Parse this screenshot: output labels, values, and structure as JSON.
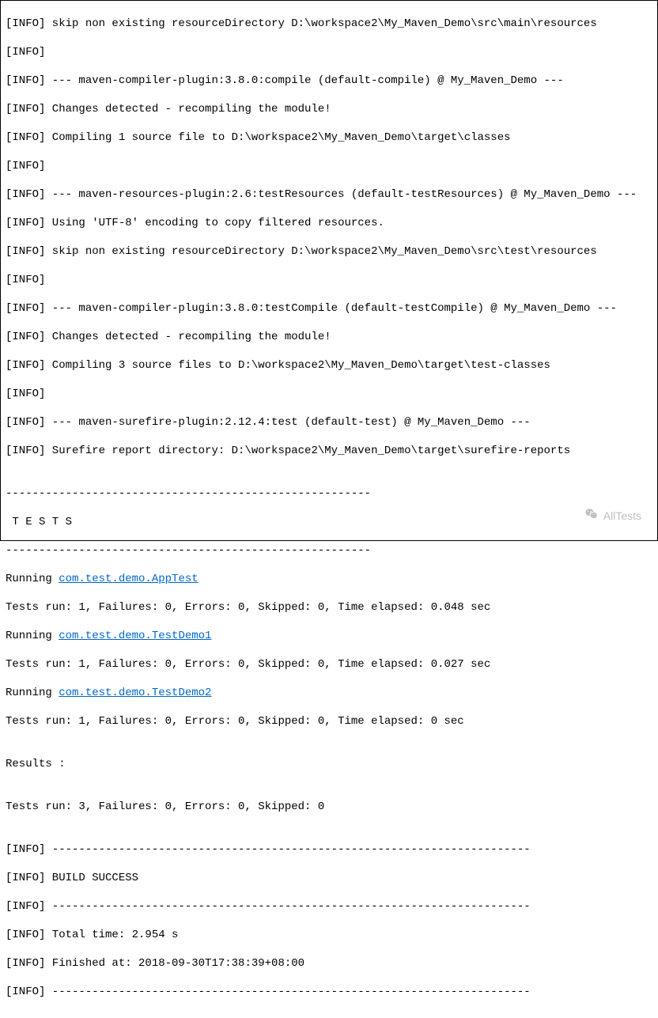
{
  "lines": {
    "l00": "[INFO] skip non existing resourceDirectory D:\\workspace2\\My_Maven_Demo\\src\\main\\resources",
    "l01": "[INFO]",
    "l02": "[INFO] --- maven-compiler-plugin:3.8.0:compile (default-compile) @ My_Maven_Demo ---",
    "l03": "[INFO] Changes detected - recompiling the module!",
    "l04": "[INFO] Compiling 1 source file to D:\\workspace2\\My_Maven_Demo\\target\\classes",
    "l05": "[INFO]",
    "l06": "[INFO] --- maven-resources-plugin:2.6:testResources (default-testResources) @ My_Maven_Demo ---",
    "l07": "[INFO] Using 'UTF-8' encoding to copy filtered resources.",
    "l08": "[INFO] skip non existing resourceDirectory D:\\workspace2\\My_Maven_Demo\\src\\test\\resources",
    "l09": "[INFO]",
    "l10": "[INFO] --- maven-compiler-plugin:3.8.0:testCompile (default-testCompile) @ My_Maven_Demo ---",
    "l11": "[INFO] Changes detected - recompiling the module!",
    "l12": "[INFO] Compiling 3 source files to D:\\workspace2\\My_Maven_Demo\\target\\test-classes",
    "l13": "[INFO]",
    "l14": "[INFO] --- maven-surefire-plugin:2.12.4:test (default-test) @ My_Maven_Demo ---",
    "l15": "[INFO] Surefire report directory: D:\\workspace2\\My_Maven_Demo\\target\\surefire-reports",
    "l16": "",
    "l17": "-------------------------------------------------------",
    "l18": " T E S T S",
    "l19": "-------------------------------------------------------",
    "l20a": "Running ",
    "l20b": "com.test.demo.AppTest",
    "l21": "Tests run: 1, Failures: 0, Errors: 0, Skipped: 0, Time elapsed: 0.048 sec",
    "l22a": "Running ",
    "l22b": "com.test.demo.TestDemo1",
    "l23": "Tests run: 1, Failures: 0, Errors: 0, Skipped: 0, Time elapsed: 0.027 sec",
    "l24a": "Running ",
    "l24b": "com.test.demo.TestDemo2",
    "l25": "Tests run: 1, Failures: 0, Errors: 0, Skipped: 0, Time elapsed: 0 sec",
    "l26": "",
    "l27": "Results :",
    "l28": "",
    "l29": "Tests run: 3, Failures: 0, Errors: 0, Skipped: 0",
    "l30": "",
    "l31": "[INFO] ------------------------------------------------------------------------",
    "l32": "[INFO] BUILD SUCCESS",
    "l33": "[INFO] ------------------------------------------------------------------------",
    "l34": "[INFO] Total time: 2.954 s",
    "l35": "[INFO] Finished at: 2018-09-30T17:38:39+08:00",
    "l36": "[INFO] ------------------------------------------------------------------------"
  },
  "watermark": "AllTests"
}
